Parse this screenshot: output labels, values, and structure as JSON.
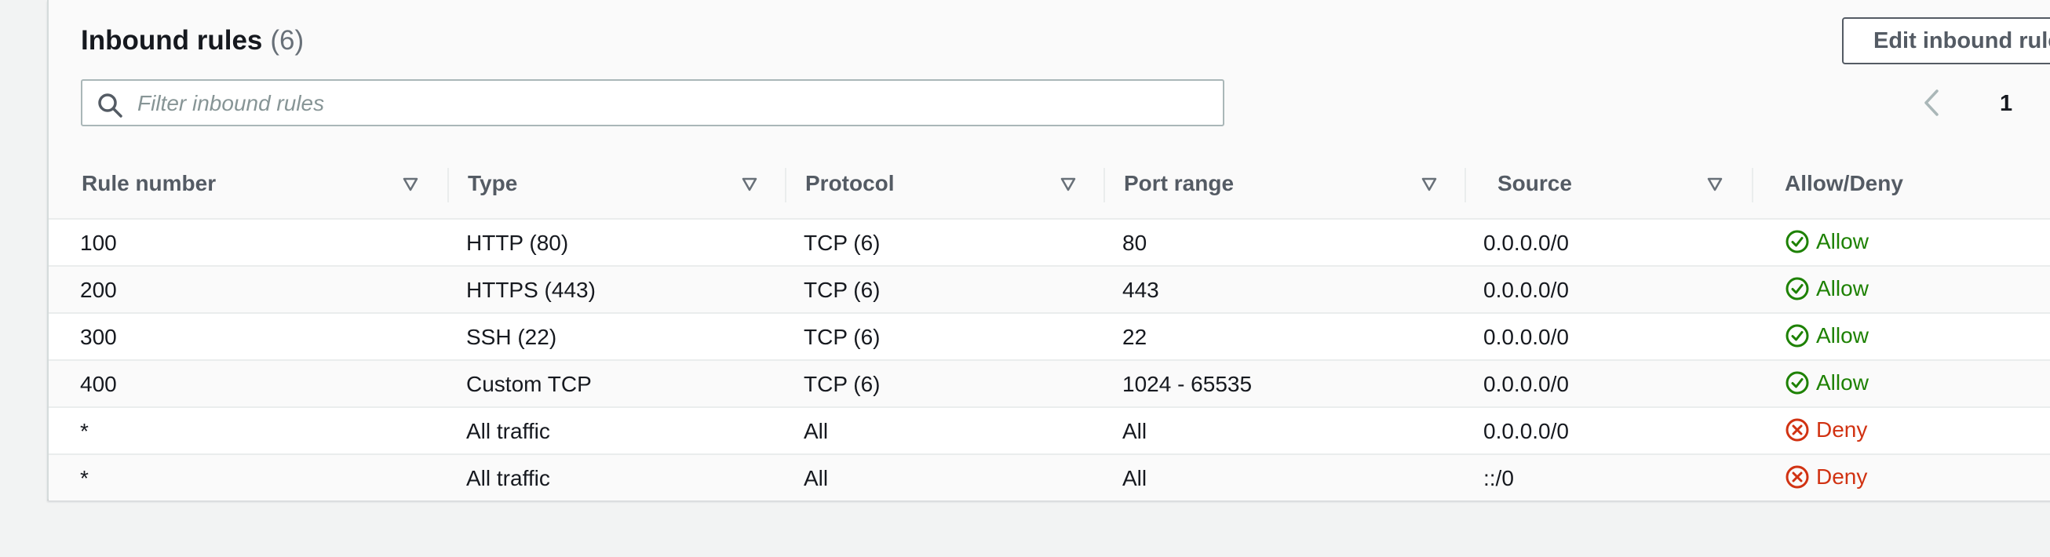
{
  "panel": {
    "title": "Inbound rules",
    "count": "(6)",
    "edit_button_label": "Edit inbound rules"
  },
  "filter": {
    "placeholder": "Filter inbound rules",
    "value": "",
    "icon": "search-icon"
  },
  "pagination": {
    "current_page": "1",
    "prev_icon": "chevron-left-icon",
    "next_icon": "chevron-right-icon"
  },
  "table": {
    "columns": [
      {
        "label": "Rule number",
        "sortable": true
      },
      {
        "label": "Type",
        "sortable": true
      },
      {
        "label": "Protocol",
        "sortable": true
      },
      {
        "label": "Port range",
        "sortable": true
      },
      {
        "label": "Source",
        "sortable": true
      },
      {
        "label": "Allow/Deny",
        "sortable": false
      }
    ],
    "rows": [
      {
        "rule": "100",
        "type": "HTTP (80)",
        "protocol": "TCP (6)",
        "port": "80",
        "source": "0.0.0.0/0",
        "action": "Allow",
        "action_kind": "allow"
      },
      {
        "rule": "200",
        "type": "HTTPS (443)",
        "protocol": "TCP (6)",
        "port": "443",
        "source": "0.0.0.0/0",
        "action": "Allow",
        "action_kind": "allow"
      },
      {
        "rule": "300",
        "type": "SSH (22)",
        "protocol": "TCP (6)",
        "port": "22",
        "source": "0.0.0.0/0",
        "action": "Allow",
        "action_kind": "allow"
      },
      {
        "rule": "400",
        "type": "Custom TCP",
        "protocol": "TCP (6)",
        "port": "1024 - 65535",
        "source": "0.0.0.0/0",
        "action": "Allow",
        "action_kind": "allow"
      },
      {
        "rule": "*",
        "type": "All traffic",
        "protocol": "All",
        "port": "All",
        "source": "0.0.0.0/0",
        "action": "Deny",
        "action_kind": "deny"
      },
      {
        "rule": "*",
        "type": "All traffic",
        "protocol": "All",
        "port": "All",
        "source": "::/0",
        "action": "Deny",
        "action_kind": "deny"
      }
    ]
  },
  "colors": {
    "allow": "#1d8102",
    "deny": "#d13212",
    "header_text": "#545b64"
  }
}
